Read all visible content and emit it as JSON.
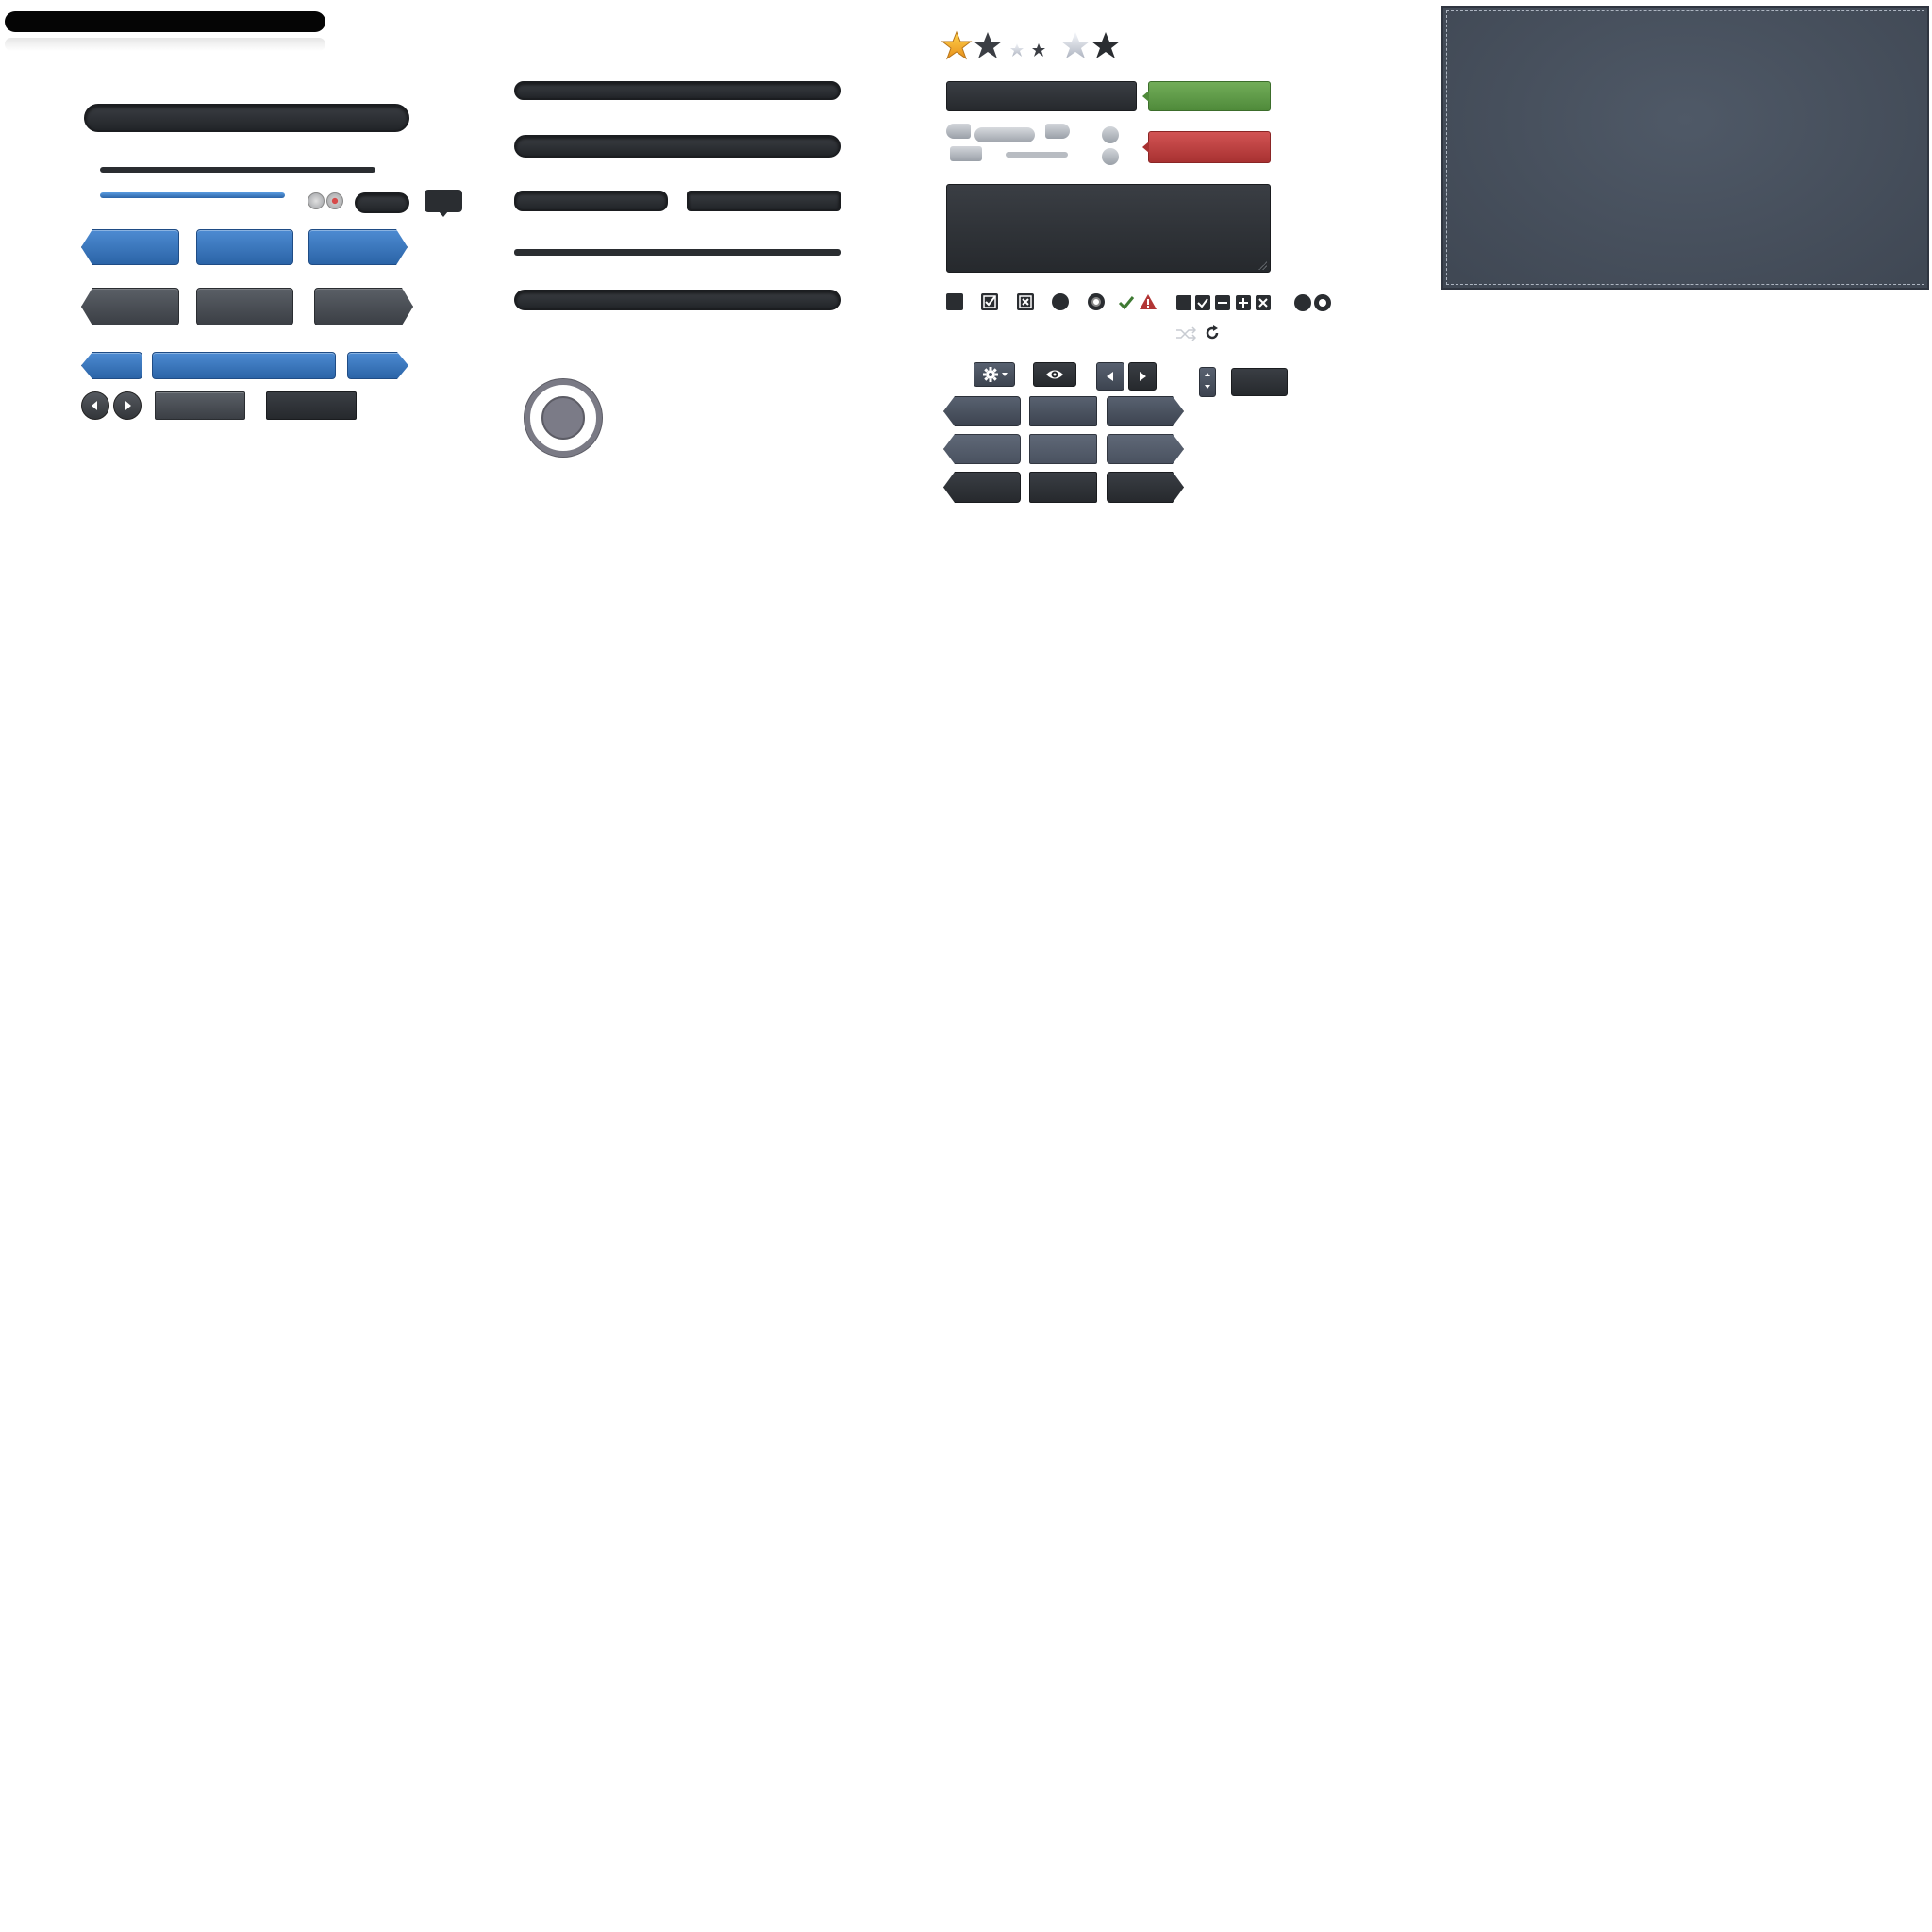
{
  "sprite_sheet": {
    "description_text": "",
    "rating": {
      "value": 1,
      "max": 2
    },
    "progress": {
      "blue_fraction": 0.69
    },
    "segmented_buttons": {
      "top_row": [
        "",
        "",
        ""
      ],
      "bottom_row": [
        "",
        "",
        ""
      ],
      "thin_row": [
        "",
        "",
        ""
      ]
    },
    "pager": {
      "prev_icon": "chevron-left-icon",
      "next_icon": "chevron-right-icon"
    },
    "toolbar": {
      "gear_icon": "gear-icon",
      "eye_icon": "eye-icon",
      "prev_icon": "triangle-left-icon",
      "next_icon": "triangle-right-icon",
      "spin_up_icon": "caret-up-icon",
      "spin_down_icon": "caret-down-icon"
    },
    "status_icons": [
      "checkmark-icon",
      "warning-icon",
      "shuffle-icon",
      "refresh-icon"
    ],
    "colors": {
      "accent_blue": "#2b64a7",
      "success_green": "#5c9a45",
      "danger_red": "#b63a3a",
      "star_gold": "#f5a623",
      "panel_slate": "#454f5b",
      "dark": "#26292d"
    },
    "drop_zone": {
      "text": ""
    }
  }
}
